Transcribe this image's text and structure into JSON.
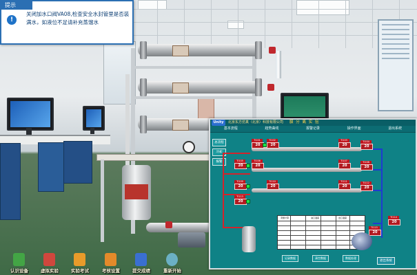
{
  "hint": {
    "title": "提示",
    "icon": "info-icon",
    "text": "关闭加水口阀VA08,检查安全水封管里是否装满水，如液位不足请补充蒸馏水"
  },
  "dcs": {
    "logo": "Unity",
    "company": "北京东方仿真（北京）科技有限公司",
    "title": "膜 分 离 实 验",
    "nav": [
      "基本流程",
      "趋势曲线",
      "报警记录",
      "操作界面",
      "退出系统"
    ],
    "side_buttons": [
      "总流程",
      "冷却",
      "报警"
    ],
    "tags": [
      {
        "tag": "TI101",
        "value": "20"
      },
      {
        "tag": "TI102",
        "value": "20"
      },
      {
        "tag": "TI103",
        "value": "20"
      },
      {
        "tag": "TI104",
        "value": "20"
      },
      {
        "tag": "TI105",
        "value": "20"
      },
      {
        "tag": "TI106",
        "value": "20"
      },
      {
        "tag": "TI107",
        "value": "20"
      },
      {
        "tag": "TI108",
        "value": "20"
      },
      {
        "tag": "TI109",
        "value": "20"
      },
      {
        "tag": "TI110",
        "value": "20"
      },
      {
        "tag": "TI111",
        "value": "20"
      },
      {
        "tag": "TI112",
        "value": "20"
      },
      {
        "tag": "TI113",
        "value": "20"
      },
      {
        "tag": "TI114",
        "value": "20"
      },
      {
        "tag": "TI115",
        "value": "20"
      }
    ],
    "table_headers": [
      "流量计算",
      "进口温度",
      "出口温度"
    ],
    "bottom_buttons": [
      "记录数据",
      "清空数据",
      "数据处理"
    ],
    "exit_button": "退出系统"
  },
  "toolbar": [
    {
      "label": "认识设备",
      "icon": "equipment-icon",
      "color": "#43a545"
    },
    {
      "label": "虚拟实验",
      "icon": "virtual-experiment-icon",
      "color": "#d0473d"
    },
    {
      "label": "实验考试",
      "icon": "exam-icon",
      "color": "#e89b2a"
    },
    {
      "label": "考核设置",
      "icon": "settings-icon",
      "color": "#e48a2a"
    },
    {
      "label": "提交成绩",
      "icon": "save-icon",
      "color": "#3a6fd1"
    },
    {
      "label": "重新开始",
      "icon": "restart-icon",
      "color": "#6bb0c4"
    }
  ]
}
